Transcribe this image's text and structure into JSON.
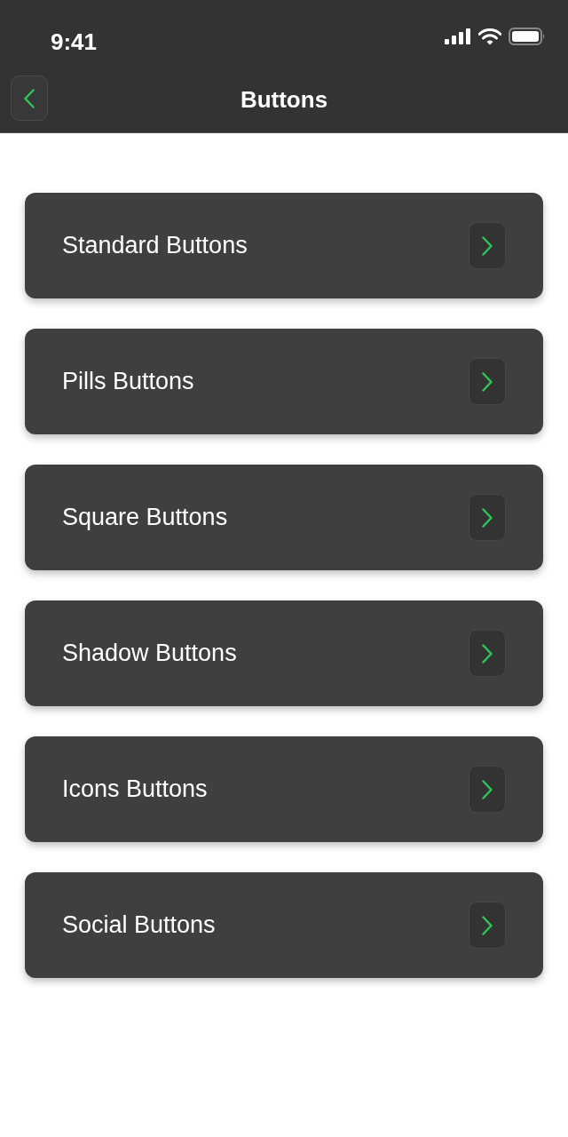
{
  "status_bar": {
    "time": "9:41"
  },
  "nav_bar": {
    "title": "Buttons"
  },
  "menu_items": [
    {
      "label": "Standard Buttons"
    },
    {
      "label": "Pills Buttons"
    },
    {
      "label": "Square Buttons"
    },
    {
      "label": "Shadow Buttons"
    },
    {
      "label": "Icons Buttons"
    },
    {
      "label": "Social Buttons"
    }
  ]
}
